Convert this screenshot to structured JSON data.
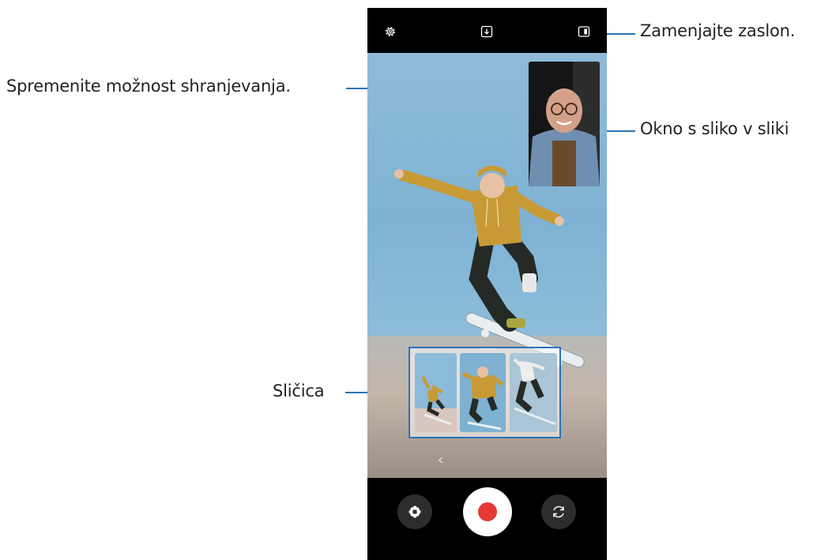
{
  "callouts": {
    "swap_screen": "Zamenjajte zaslon.",
    "change_save_option": "Spremenite možnost shranjevanja.",
    "pip_window": "Okno s sliko v sliki",
    "thumbnail": "Sličica"
  },
  "icons": {
    "settings": "gear-icon",
    "save_option": "download-icon",
    "swap_screen": "split-screen-icon",
    "effects": "flower-effect-icon",
    "record": "record-icon",
    "switch_camera": "switch-camera-icon",
    "collapse": "chevron-left-icon"
  },
  "colors": {
    "callout_line": "#2a73b8",
    "record_dot": "#e53935",
    "ui_background": "#000000"
  }
}
